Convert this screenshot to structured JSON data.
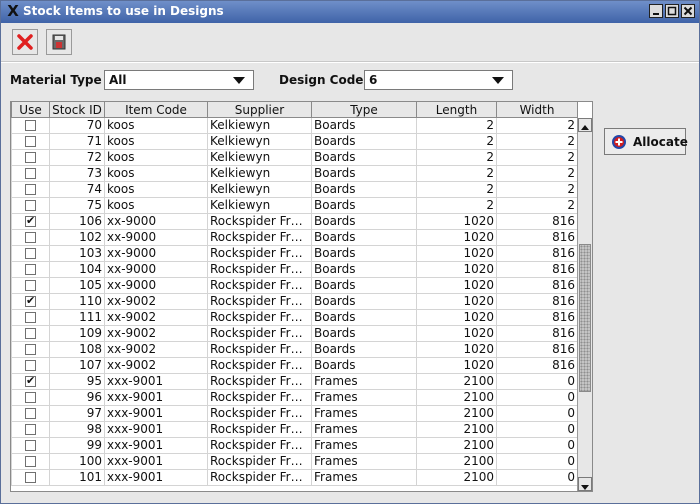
{
  "window": {
    "title": "Stock Items to use in Designs"
  },
  "toolbar": {
    "icons": [
      "delete-icon",
      "save-icon"
    ]
  },
  "filters": {
    "material_type_label": "Material Type",
    "material_type_value": "All",
    "design_code_label": "Design Code",
    "design_code_value": "6"
  },
  "table": {
    "columns": [
      "Use",
      "Stock ID",
      "Item Code",
      "Supplier",
      "Type",
      "Length",
      "Width"
    ],
    "rows": [
      {
        "use": false,
        "stock_id": "70",
        "item_code": "koos",
        "supplier": "Kelkiewyn",
        "type": "Boards",
        "length": "2",
        "width": "2"
      },
      {
        "use": false,
        "stock_id": "71",
        "item_code": "koos",
        "supplier": "Kelkiewyn",
        "type": "Boards",
        "length": "2",
        "width": "2"
      },
      {
        "use": false,
        "stock_id": "72",
        "item_code": "koos",
        "supplier": "Kelkiewyn",
        "type": "Boards",
        "length": "2",
        "width": "2"
      },
      {
        "use": false,
        "stock_id": "73",
        "item_code": "koos",
        "supplier": "Kelkiewyn",
        "type": "Boards",
        "length": "2",
        "width": "2"
      },
      {
        "use": false,
        "stock_id": "74",
        "item_code": "koos",
        "supplier": "Kelkiewyn",
        "type": "Boards",
        "length": "2",
        "width": "2"
      },
      {
        "use": false,
        "stock_id": "75",
        "item_code": "koos",
        "supplier": "Kelkiewyn",
        "type": "Boards",
        "length": "2",
        "width": "2"
      },
      {
        "use": true,
        "stock_id": "106",
        "item_code": "xx-9000",
        "supplier": "Rockspider Fra...",
        "type": "Boards",
        "length": "1020",
        "width": "816"
      },
      {
        "use": false,
        "stock_id": "102",
        "item_code": "xx-9000",
        "supplier": "Rockspider Fra...",
        "type": "Boards",
        "length": "1020",
        "width": "816"
      },
      {
        "use": false,
        "stock_id": "103",
        "item_code": "xx-9000",
        "supplier": "Rockspider Fra...",
        "type": "Boards",
        "length": "1020",
        "width": "816"
      },
      {
        "use": false,
        "stock_id": "104",
        "item_code": "xx-9000",
        "supplier": "Rockspider Fra...",
        "type": "Boards",
        "length": "1020",
        "width": "816"
      },
      {
        "use": false,
        "stock_id": "105",
        "item_code": "xx-9000",
        "supplier": "Rockspider Fra...",
        "type": "Boards",
        "length": "1020",
        "width": "816"
      },
      {
        "use": true,
        "stock_id": "110",
        "item_code": "xx-9002",
        "supplier": "Rockspider Fra...",
        "type": "Boards",
        "length": "1020",
        "width": "816"
      },
      {
        "use": false,
        "stock_id": "111",
        "item_code": "xx-9002",
        "supplier": "Rockspider Fra...",
        "type": "Boards",
        "length": "1020",
        "width": "816"
      },
      {
        "use": false,
        "stock_id": "109",
        "item_code": "xx-9002",
        "supplier": "Rockspider Fra...",
        "type": "Boards",
        "length": "1020",
        "width": "816"
      },
      {
        "use": false,
        "stock_id": "108",
        "item_code": "xx-9002",
        "supplier": "Rockspider Fra...",
        "type": "Boards",
        "length": "1020",
        "width": "816"
      },
      {
        "use": false,
        "stock_id": "107",
        "item_code": "xx-9002",
        "supplier": "Rockspider Fra...",
        "type": "Boards",
        "length": "1020",
        "width": "816"
      },
      {
        "use": true,
        "stock_id": "95",
        "item_code": "xxx-9001",
        "supplier": "Rockspider Fra...",
        "type": "Frames",
        "length": "2100",
        "width": "0"
      },
      {
        "use": false,
        "stock_id": "96",
        "item_code": "xxx-9001",
        "supplier": "Rockspider Fra...",
        "type": "Frames",
        "length": "2100",
        "width": "0"
      },
      {
        "use": false,
        "stock_id": "97",
        "item_code": "xxx-9001",
        "supplier": "Rockspider Fra...",
        "type": "Frames",
        "length": "2100",
        "width": "0"
      },
      {
        "use": false,
        "stock_id": "98",
        "item_code": "xxx-9001",
        "supplier": "Rockspider Fra...",
        "type": "Frames",
        "length": "2100",
        "width": "0"
      },
      {
        "use": false,
        "stock_id": "99",
        "item_code": "xxx-9001",
        "supplier": "Rockspider Fra...",
        "type": "Frames",
        "length": "2100",
        "width": "0"
      },
      {
        "use": false,
        "stock_id": "100",
        "item_code": "xxx-9001",
        "supplier": "Rockspider Fra...",
        "type": "Frames",
        "length": "2100",
        "width": "0"
      },
      {
        "use": false,
        "stock_id": "101",
        "item_code": "xxx-9001",
        "supplier": "Rockspider Fra...",
        "type": "Frames",
        "length": "2100",
        "width": "0"
      }
    ]
  },
  "scrollbar": {
    "position_fraction": 0.57,
    "visible_fraction": 0.43
  },
  "actions": {
    "allocate_label": "Allocate"
  },
  "colors": {
    "titlebar": "#4a6cb0",
    "allocate_icon": "#d21e1e",
    "delete_icon": "#e02020"
  }
}
